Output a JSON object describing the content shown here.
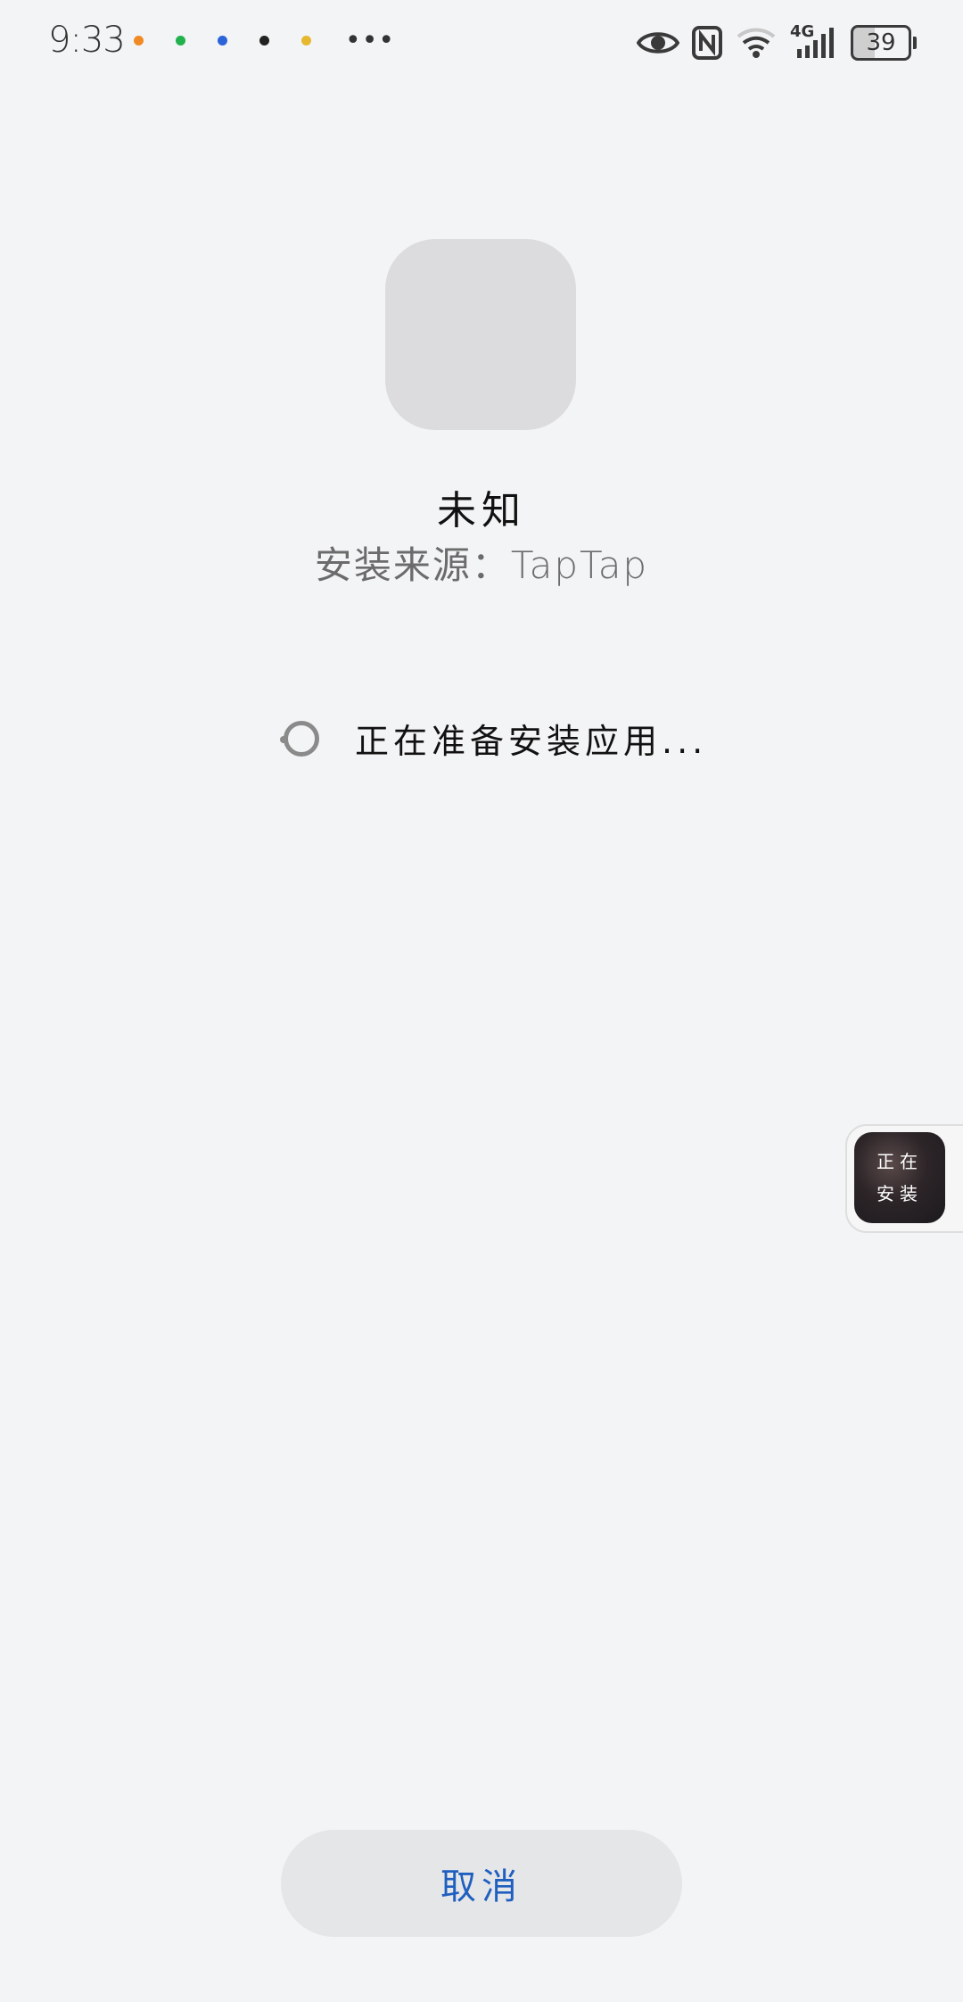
{
  "status_bar": {
    "time": "9:33",
    "network_type": "4G",
    "battery_level": "39",
    "notification_colors": [
      "#f08a24",
      "#22b14c",
      "#2b63d9",
      "#222222",
      "#e6b82e"
    ]
  },
  "app": {
    "name": "未知",
    "source": "安装来源：TapTap"
  },
  "progress": {
    "status_text": "正在准备安装应用..."
  },
  "floating_window": {
    "line1": "正在",
    "line2": "安装"
  },
  "actions": {
    "cancel_label": "取消"
  },
  "colors": {
    "accent": "#1f5fbf",
    "background": "#f3f4f6"
  }
}
